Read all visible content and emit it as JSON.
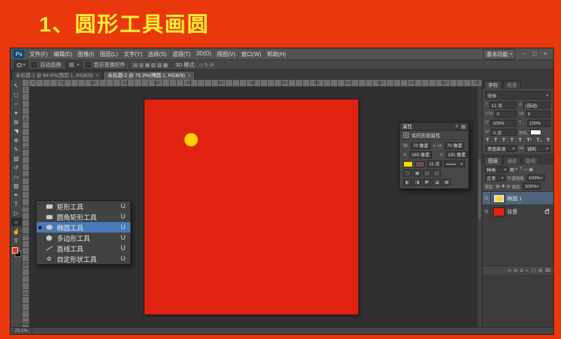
{
  "page": {
    "heading": "1、圆形工具画圆"
  },
  "colors": {
    "background_red": "#e8380c",
    "heading_yellow": "#ffee33",
    "document_red": "#e02311",
    "circle_yellow": "#ffd400",
    "selection_blue": "#4a79b8"
  },
  "icons": {
    "caret_down": "▾",
    "eye": "⊙",
    "link": "∞",
    "menu": "▤",
    "collapse": "«",
    "close": "✕"
  },
  "window": {
    "menubar": {
      "logo": "Ps",
      "items": [
        "文件(F)",
        "编辑(E)",
        "图像(I)",
        "图层(L)",
        "文字(Y)",
        "选择(S)",
        "滤镜(T)",
        "3D(D)",
        "视图(V)",
        "窗口(W)",
        "帮助(H)"
      ],
      "workspace": "基本功能",
      "controls": {
        "minimize": "—",
        "restore": "▢",
        "close": "✕"
      }
    },
    "optionsbar": {
      "auto_select_label": "自动选择:",
      "auto_select_value": "组",
      "show_transform_label": "显示变换控件",
      "mode_label": "3D 模式:",
      "align_icons": [
        "▤",
        "▥",
        "▦",
        "▧",
        "▨",
        "▩"
      ],
      "mode_icons": [
        "◇",
        "↻",
        "⇄"
      ]
    },
    "tabbar": {
      "tabs": [
        {
          "title": "未标题-1 @ 84.6%(图层 1, RGB/8)",
          "close": "×"
        },
        {
          "title": "未标题-2 @ 75.3%(椭圆 1, RGB/8)",
          "close": "×"
        }
      ]
    },
    "toolbar": {
      "active_index": 15,
      "tools": [
        {
          "name": "move-tool-icon",
          "glyph": "↖"
        },
        {
          "name": "marquee-tool-icon",
          "glyph": "◻"
        },
        {
          "name": "lasso-tool-icon",
          "glyph": "∽"
        },
        {
          "name": "quick-selection-tool-icon",
          "glyph": "✦"
        },
        {
          "name": "crop-tool-icon",
          "glyph": "⊞"
        },
        {
          "name": "eyedropper-tool-icon",
          "glyph": "◥"
        },
        {
          "name": "healing-brush-tool-icon",
          "glyph": "⊕"
        },
        {
          "name": "brush-tool-icon",
          "glyph": "✎"
        },
        {
          "name": "clone-stamp-tool-icon",
          "glyph": "▧"
        },
        {
          "name": "history-brush-tool-icon",
          "glyph": "↺"
        },
        {
          "name": "eraser-tool-icon",
          "glyph": "▭"
        },
        {
          "name": "gradient-tool-icon",
          "glyph": "▨"
        },
        {
          "name": "pen-tool-icon",
          "glyph": "✒"
        },
        {
          "name": "type-tool-icon",
          "glyph": "T"
        },
        {
          "name": "path-selection-tool-icon",
          "glyph": "▷"
        },
        {
          "name": "shape-tool-icon",
          "glyph": "○"
        },
        {
          "name": "hand-tool-icon",
          "glyph": "☝"
        },
        {
          "name": "zoom-tool-icon",
          "glyph": "⚲"
        }
      ]
    },
    "ruler": {
      "h_labels": [
        "0",
        "50",
        "100",
        "150",
        "200",
        "250",
        "300",
        "350",
        "400",
        "450",
        "500",
        "550",
        "600",
        "650",
        "700"
      ],
      "v_labels": [
        "0",
        "50",
        "100",
        "150",
        "200",
        "250",
        "300",
        "350",
        "400"
      ]
    },
    "statusbar": {
      "zoom": "75.1%"
    }
  },
  "flyout": {
    "items": [
      {
        "label": "矩形工具",
        "shortcut": "U",
        "selected": false
      },
      {
        "label": "圆角矩形工具",
        "shortcut": "U",
        "selected": false
      },
      {
        "label": "椭圆工具",
        "shortcut": "U",
        "selected": true
      },
      {
        "label": "多边形工具",
        "shortcut": "U",
        "selected": false
      },
      {
        "label": "直线工具",
        "shortcut": "U",
        "selected": false
      },
      {
        "label": "自定形状工具",
        "shortcut": "U",
        "selected": false
      }
    ]
  },
  "properties": {
    "tab": "属性",
    "title": "实时形状属性",
    "w_label": "W:",
    "w_value": "70 像素",
    "h_label": "H:",
    "h_value": "70 像素",
    "x_label": "X:",
    "x_value": "165 像素",
    "y_label": "Y:",
    "y_value": "191 像素",
    "stroke_width": "11 点",
    "buttons_row1": [
      "▢",
      "▣",
      "◫",
      "◰"
    ],
    "buttons_row2": [
      "◧",
      "◨",
      "◩",
      "◪",
      "▦"
    ]
  },
  "character": {
    "tab": "字符",
    "tab2": "段落",
    "font_value": "宋体",
    "size_value": "12 点",
    "leading_value": "(自动)",
    "kerning_value": "0",
    "tracking_value": "0",
    "vscale_value": "100%",
    "hscale_value": "100%",
    "baseline_value": "0 点",
    "color_label": "颜色:",
    "style_buttons": [
      "T",
      "T",
      "T",
      "T",
      "T",
      "T¹",
      "T₁",
      "Ŧ"
    ],
    "lang_value": "美国英语",
    "aa_prefix": "aa",
    "aa_value": "锐利"
  },
  "layers": {
    "tab": "图层",
    "tab2": "通道",
    "tab3": "路径",
    "filter_label": "种类",
    "filter_icons": [
      "▦",
      "◐",
      "T",
      "▱",
      "▣"
    ],
    "blend_value": "正常",
    "opacity_label": "不透明度:",
    "opacity_value": "100%",
    "lock_label": "锁定:",
    "lock_icons": [
      "▨",
      "✚",
      "⊕"
    ],
    "fill_label": "填充:",
    "fill_value": "100%",
    "items": [
      {
        "name": "椭圆 1"
      },
      {
        "name": "背景"
      }
    ],
    "footer_icons": [
      {
        "name": "link-layers-icon",
        "glyph": "∞"
      },
      {
        "name": "layer-effects-icon",
        "glyph": "fx"
      },
      {
        "name": "layer-mask-icon",
        "glyph": "◘"
      },
      {
        "name": "adjustment-layer-icon",
        "glyph": "◐"
      },
      {
        "name": "layer-group-icon",
        "glyph": "▢"
      },
      {
        "name": "new-layer-icon",
        "glyph": "⊞"
      },
      {
        "name": "delete-layer-icon",
        "glyph": "⌧"
      }
    ]
  }
}
